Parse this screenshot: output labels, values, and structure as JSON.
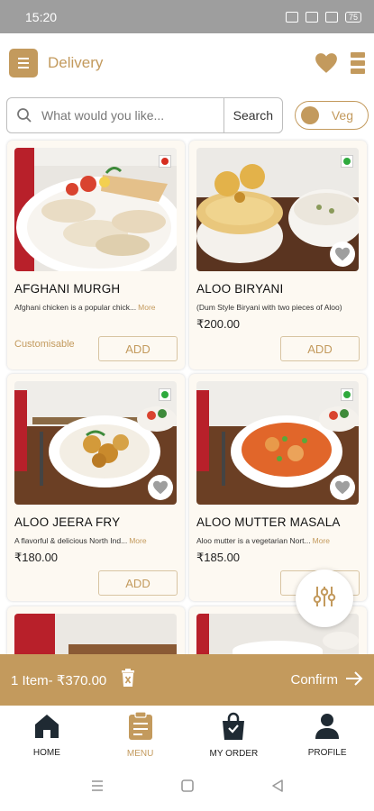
{
  "status_bar": {
    "time": "15:20",
    "battery": "75"
  },
  "header": {
    "title": "Delivery"
  },
  "search": {
    "placeholder": "What would you like...",
    "button_label": "Search"
  },
  "veg_toggle": {
    "label": "Veg"
  },
  "colors": {
    "accent": "#c39a5d",
    "veg": "#2eaa3d",
    "nonveg": "#d62d20"
  },
  "products": [
    {
      "name": "AFGHANI MURGH",
      "description": "Afghani chicken is a popular chick...",
      "more": "More",
      "price": "",
      "customisable": "Customisable",
      "add": "ADD",
      "veg": false,
      "image": "afghani-murgh"
    },
    {
      "name": "ALOO BIRYANI",
      "description": "(Dum Style Biryani with two pieces of Aloo)",
      "more": "",
      "price": "₹200.00",
      "customisable": "",
      "add": "ADD",
      "veg": true,
      "image": "aloo-biryani"
    },
    {
      "name": "ALOO JEERA FRY",
      "description": "A flavorful & delicious North Ind...",
      "more": "More",
      "price": "₹180.00",
      "customisable": "",
      "add": "ADD",
      "veg": true,
      "image": "aloo-jeera-fry"
    },
    {
      "name": "ALOO MUTTER MASALA",
      "description": "Aloo mutter is a vegetarian Nort...",
      "more": "More",
      "price": "₹185.00",
      "customisable": "",
      "add": "ADD",
      "veg": true,
      "image": "aloo-mutter-masala"
    }
  ],
  "cart": {
    "summary": "1 Item- ₹370.00",
    "confirm_label": "Confirm"
  },
  "bottom_nav": [
    {
      "label": "HOME",
      "icon": "home-icon"
    },
    {
      "label": "MENU",
      "icon": "menu-clipboard-icon",
      "active": true
    },
    {
      "label": "MY ORDER",
      "icon": "shopping-bag-icon"
    },
    {
      "label": "PROFILE",
      "icon": "profile-icon"
    }
  ]
}
